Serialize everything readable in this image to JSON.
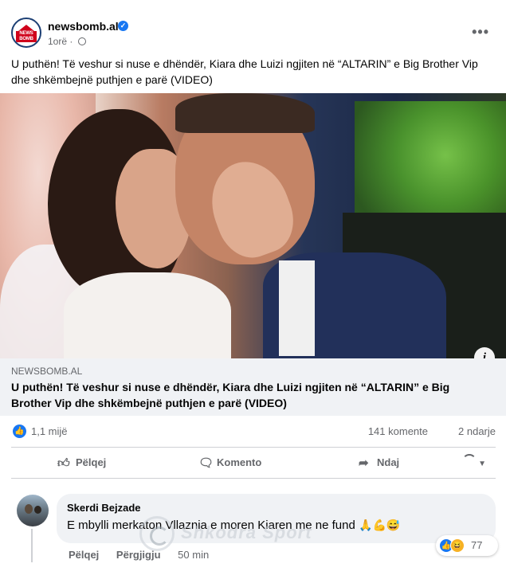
{
  "post": {
    "page_name": "newsbomb.al",
    "logo_text": "NEWS BOMB",
    "time": "1orë",
    "text": "U puthën! Të veshur si nuse e dhëndër, Kiara dhe Luizi ngjiten në “ALTARIN” e Big Brother Vip dhe shkëmbejnë puthjen e parë (VIDEO)"
  },
  "link_preview": {
    "domain": "NEWSBOMB.AL",
    "title": "U puthën! Të veshur si nuse e dhëndër, Kiara dhe Luizi ngjiten në “ALTARIN” e Big Brother Vip dhe shkëmbejnë puthjen e parë (VIDEO)"
  },
  "stats": {
    "reactions": "1,1 mijë",
    "comments": "141 komente",
    "shares": "2 ndarje"
  },
  "actions": {
    "like": "Pëlqej",
    "comment": "Komento",
    "share": "Ndaj"
  },
  "comment": {
    "author": "Skerdi Bejzade",
    "text": "E mbylli merkaton Vllaznia e moren Kiaren me ne fund",
    "emojis": "🙏💪😅",
    "like_label": "Pëlqej",
    "reply_label": "Përgjigju",
    "time": "50 min",
    "reaction_count": "77"
  },
  "watermark": {
    "text": "Shkodra Sport"
  },
  "icons": {
    "more": "more-horizontal-icon",
    "verified": "verified-badge-icon",
    "globe": "globe-icon",
    "info": "info-icon",
    "like": "thumbs-up-icon",
    "comment": "comment-bubble-icon",
    "share": "share-arrow-icon"
  },
  "colors": {
    "accent": "#1877f2",
    "secondary_text": "#65676b",
    "link_box_bg": "#f0f2f5",
    "logo_red": "#d0021b"
  }
}
